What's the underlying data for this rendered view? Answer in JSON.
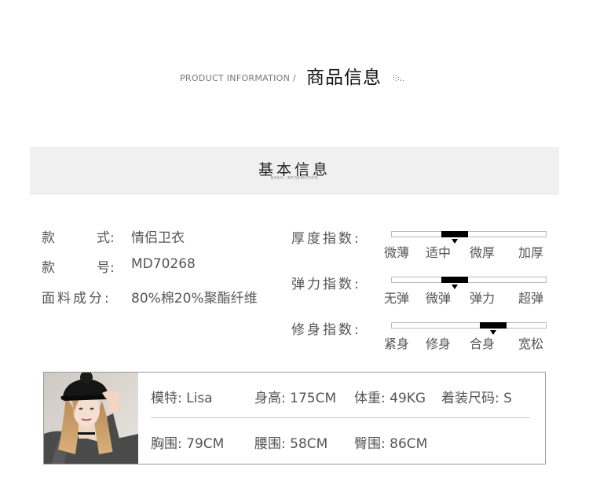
{
  "header": {
    "en": "PRODUCT INFORMATION /",
    "zh": "商品信息"
  },
  "basic": {
    "title": "基本信息",
    "subtitle": "BASIC INFORMATION"
  },
  "attributes": [
    {
      "label_chars": [
        "款",
        "式:"
      ],
      "value": "情侣卫衣"
    },
    {
      "label_chars": [
        "款",
        "号:"
      ],
      "value": "MD70268"
    },
    {
      "label_chars": [
        "面料成分:"
      ],
      "value": "80%棉20%聚酯纤维"
    }
  ],
  "indices": [
    {
      "name": "厚度指数:",
      "options": [
        "微薄",
        "适中",
        "微厚",
        "加厚"
      ],
      "selected": "适中",
      "selected_index": 1
    },
    {
      "name": "弹力指数:",
      "options": [
        "无弹",
        "微弹",
        "弹力",
        "超弹"
      ],
      "selected": "微弹",
      "selected_index": 1
    },
    {
      "name": "修身指数:",
      "options": [
        "紧身",
        "修身",
        "合身",
        "宽松"
      ],
      "selected": "合身",
      "selected_index": 2
    }
  ],
  "model": {
    "name": "模特: Lisa",
    "height": "身高: 175CM",
    "weight": "体重: 49KG",
    "size": "着装尺码: S",
    "chest": "胸围: 79CM",
    "waist": "腰围: 58CM",
    "hip": "臀围: 86CM"
  },
  "colors": {
    "banner_bg": "#f0f0f0",
    "indicator": "#000000",
    "text": "#555555"
  }
}
